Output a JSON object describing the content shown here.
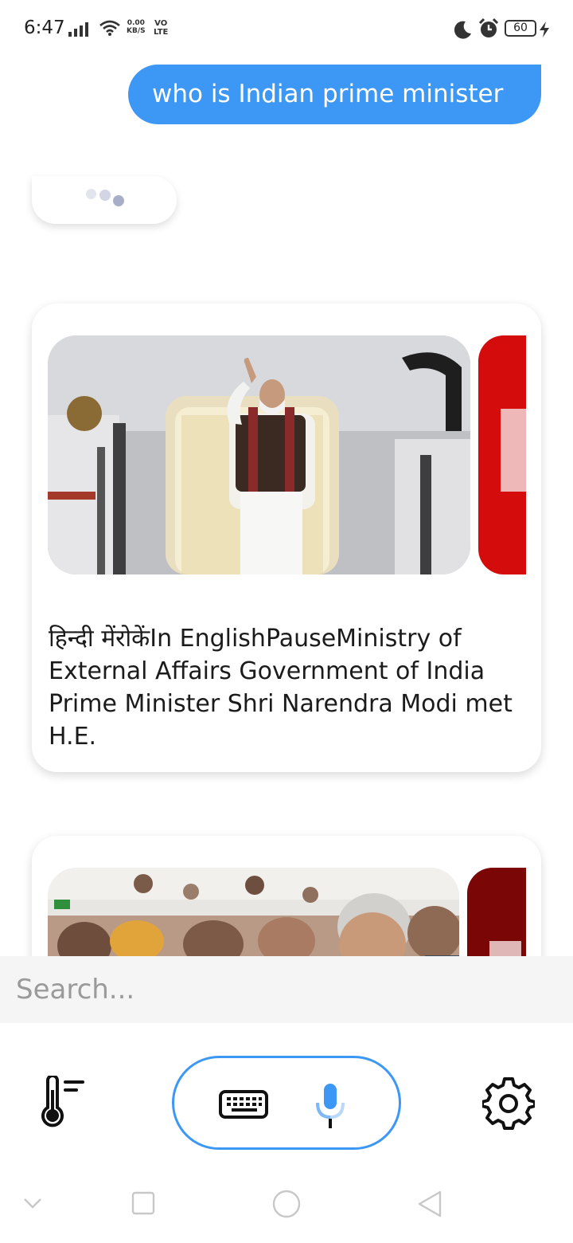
{
  "status_bar": {
    "time": "6:47",
    "net_speed_value": "0.00",
    "net_speed_unit": "KB/S",
    "volte_top": "VO",
    "volte_bottom": "LTE",
    "battery": "60",
    "icons": [
      "signal-icon",
      "wifi-icon",
      "moon-icon",
      "alarm-icon",
      "charging-icon"
    ]
  },
  "chat": {
    "user_message": "who is Indian prime minister",
    "bot_typing": true
  },
  "cards": [
    {
      "text": "हिन्दी मेंरोकेंIn EnglishPauseMinistry of External Affairs Government of India Prime Minister Shri Narendra Modi met H.E."
    },
    {
      "text": ""
    }
  ],
  "search": {
    "placeholder": "Search..."
  },
  "controls": {
    "accent_color": "#3d97f5",
    "icons": [
      "thermometer-icon",
      "keyboard-icon",
      "microphone-icon",
      "gear-icon"
    ]
  },
  "nav": {
    "icons": [
      "chevron-down-icon",
      "recent-apps-icon",
      "home-icon",
      "back-icon"
    ]
  }
}
